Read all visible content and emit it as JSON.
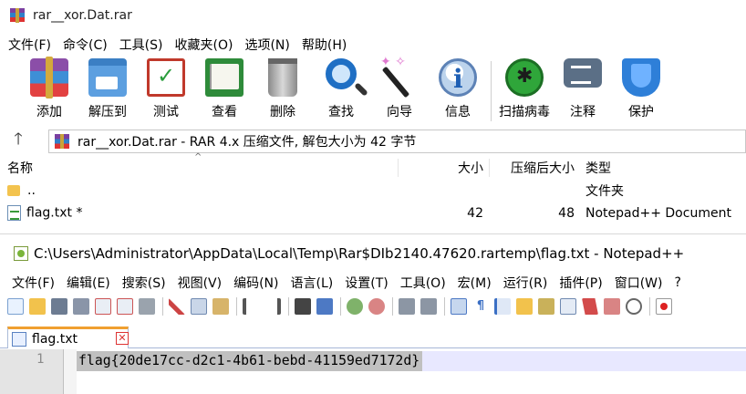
{
  "rar": {
    "title": "rar__xor.Dat.rar",
    "menu": [
      "文件(F)",
      "命令(C)",
      "工具(S)",
      "收藏夹(O)",
      "选项(N)",
      "帮助(H)"
    ],
    "toolbar": [
      {
        "label": "添加",
        "icon": "add-archive-icon"
      },
      {
        "label": "解压到",
        "icon": "extract-to-icon"
      },
      {
        "label": "测试",
        "icon": "test-icon"
      },
      {
        "label": "查看",
        "icon": "view-book-icon"
      },
      {
        "label": "删除",
        "icon": "trash-icon"
      },
      {
        "label": "查找",
        "icon": "magnifier-icon"
      },
      {
        "label": "向导",
        "icon": "wizard-wand-icon"
      },
      {
        "label": "信息",
        "icon": "info-icon"
      },
      {
        "label": "扫描病毒",
        "icon": "virus-scan-icon"
      },
      {
        "label": "注释",
        "icon": "comment-icon"
      },
      {
        "label": "保护",
        "icon": "shield-icon"
      }
    ],
    "address": "rar__xor.Dat.rar - RAR 4.x 压缩文件, 解包大小为 42 字节",
    "columns": {
      "name": "名称",
      "size": "大小",
      "packed": "压缩后大小",
      "type": "类型"
    },
    "rows": [
      {
        "name": "..",
        "size": "",
        "packed": "",
        "type": "文件夹"
      },
      {
        "name": "flag.txt *",
        "size": "42",
        "packed": "48",
        "type": "Notepad++ Document"
      }
    ]
  },
  "npp": {
    "title": "C:\\Users\\Administrator\\AppData\\Local\\Temp\\Rar$DIb2140.47620.rartemp\\flag.txt - Notepad++",
    "menu": [
      "文件(F)",
      "编辑(E)",
      "搜索(S)",
      "视图(V)",
      "编码(N)",
      "语言(L)",
      "设置(T)",
      "工具(O)",
      "宏(M)",
      "运行(R)",
      "插件(P)",
      "窗口(W)",
      "?"
    ],
    "tab": {
      "label": "flag.txt",
      "close": "✕"
    },
    "line_number": "1",
    "content": "flag{20de17cc-d2c1-4b61-bebd-41159ed7172d}"
  },
  "colors": {
    "current_line": "#e8e8ff",
    "selection": "#c0c0c0",
    "tab_accent": "#f0a030"
  }
}
